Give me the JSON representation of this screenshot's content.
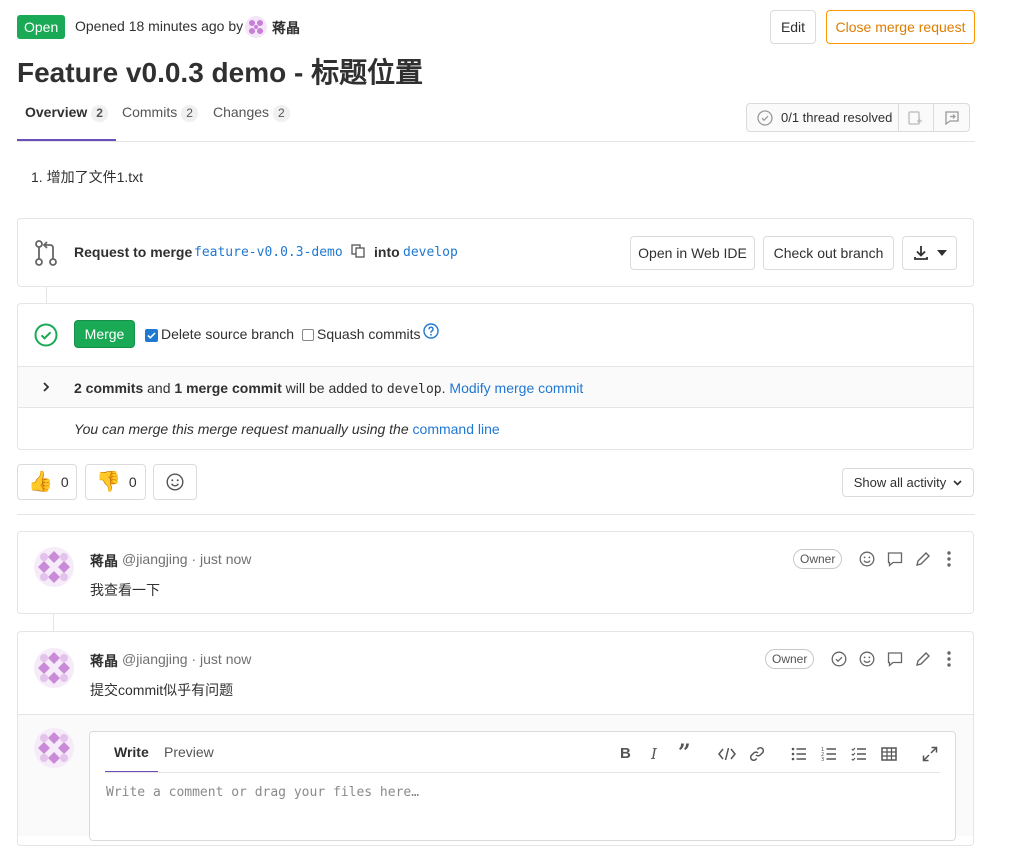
{
  "header": {
    "status": "Open",
    "opened_text": "Opened 18 minutes ago by",
    "author": "蒋晶",
    "edit_label": "Edit",
    "close_label": "Close merge request",
    "title": "Feature v0.0.3 demo - 标题位置"
  },
  "tabs": [
    {
      "label": "Overview",
      "count": "2"
    },
    {
      "label": "Commits",
      "count": "2"
    },
    {
      "label": "Changes",
      "count": "2"
    }
  ],
  "thread_status": "0/1 thread resolved",
  "description": "1. 增加了文件1.txt",
  "merge_request": {
    "request_label": "Request to merge",
    "source_branch": "feature-v0.0.3-demo",
    "into_label": "into",
    "target_branch": "develop",
    "web_ide_label": "Open in Web IDE",
    "checkout_label": "Check out branch"
  },
  "merge_widget": {
    "merge_label": "Merge",
    "delete_source_label": "Delete source branch",
    "delete_source_checked": true,
    "squash_label": "Squash commits",
    "squash_checked": false,
    "commits_bold": "2 commits",
    "and_text": "and",
    "merge_commit_bold": "1 merge commit",
    "will_be_added": "will be added to",
    "target": "develop",
    "period": ".",
    "modify_link": "Modify merge commit",
    "manual_text": "You can merge this merge request manually using the",
    "command_line_link": "command line"
  },
  "reactions": {
    "thumbsup": "0",
    "thumbsdown": "0"
  },
  "activity_filter": "Show all activity",
  "notes": [
    {
      "author": "蒋晶",
      "handle": "@jiangjing · just now",
      "role": "Owner",
      "body": "我查看一下"
    },
    {
      "author": "蒋晶",
      "handle": "@jiangjing · just now",
      "role": "Owner",
      "body": "提交commit似乎有问题"
    }
  ],
  "editor": {
    "write_tab": "Write",
    "preview_tab": "Preview",
    "placeholder": "Write a comment or drag your files here…"
  },
  "colors": {
    "status_green": "#1aaa55",
    "link_blue": "#1f78d1",
    "close_orange": "#fc9403",
    "tab_underline": "#6b4fbb"
  }
}
